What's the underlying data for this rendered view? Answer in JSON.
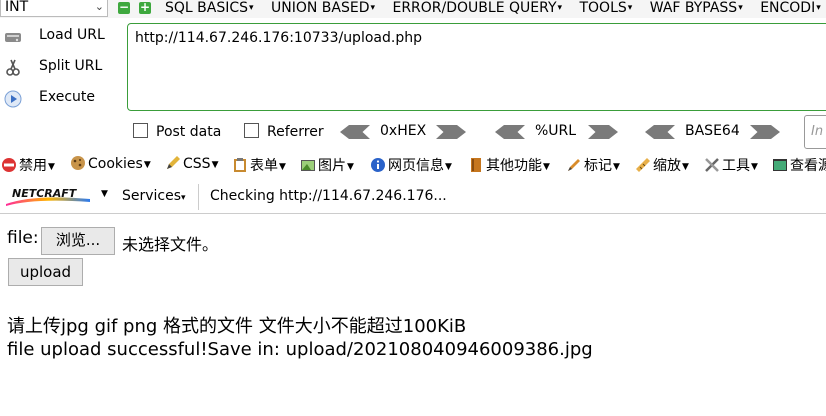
{
  "hackbar": {
    "type_select": "INT",
    "menus": [
      "SQL BASICS",
      "UNION BASED",
      "ERROR/DOUBLE QUERY",
      "TOOLS",
      "WAF BYPASS",
      "ENCODI"
    ],
    "actions": {
      "load": "Load URL",
      "split": "Split URL",
      "execute": "Execute"
    },
    "url": "http://114.67.246.176:10733/upload.php",
    "post_data": "Post data",
    "referrer": "Referrer",
    "enc_hex": "0xHEX",
    "enc_url": "%URL",
    "enc_base64": "BASE64",
    "side_input_placeholder": "In"
  },
  "webdev": {
    "items": [
      "禁用",
      "Cookies",
      "CSS",
      "表单",
      "图片",
      "网页信息",
      "其他功能",
      "标记",
      "缩放",
      "工具",
      "查看源"
    ]
  },
  "netcraft": {
    "logo_text": "NETCRAFT",
    "services": "Services",
    "checking": "Checking http://114.67.246.176..."
  },
  "page": {
    "file_label": "file:",
    "browse_label": "浏览...",
    "no_file": "未选择文件。",
    "upload_label": "upload",
    "instruction": "请上传jpg gif png 格式的文件 文件大小不能超过100KiB",
    "result": "file upload successful!Save in: upload/20210804094600938​6.jpg"
  },
  "colors": {
    "green": "#3ea83e",
    "border_green": "#3a9d3a"
  }
}
